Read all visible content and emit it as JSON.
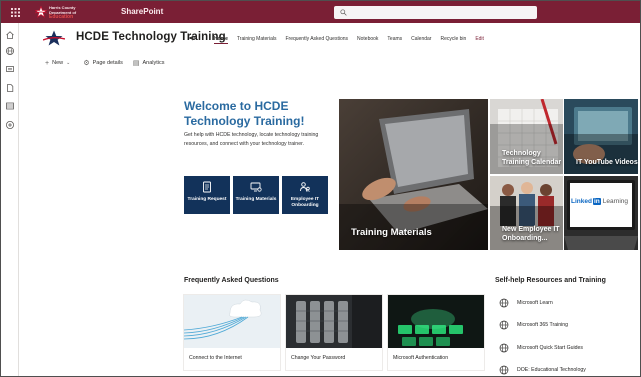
{
  "suite": {
    "app_name": "SharePoint",
    "logo_line1": "Harris County",
    "logo_line2": "Department of",
    "logo_line3": "Education",
    "search_placeholder": "",
    "brand_color": "#7a1f35"
  },
  "site": {
    "title": "HCDE Technology Training",
    "nav": [
      "Home",
      "Training Materials",
      "Frequently Asked Questions",
      "Notebook",
      "Teams",
      "Calendar",
      "Recycle bin",
      "Edit"
    ],
    "active_nav": "Home"
  },
  "commandbar": {
    "new_label": "New",
    "page_details_label": "Page details",
    "analytics_label": "Analytics"
  },
  "welcome": {
    "title": "Welcome to HCDE Technology Training!",
    "description": "Get help with HCDE technology, locate technology training resources, and connect with your technology trainer.",
    "buttons": [
      {
        "label": "Training Request",
        "icon": "document-icon"
      },
      {
        "label": "Training Materials",
        "icon": "monitor-settings-icon"
      },
      {
        "label": "Employee IT Onboarding",
        "icon": "people-icon"
      }
    ]
  },
  "hero": {
    "main_caption": "Training Materials",
    "tiles": [
      {
        "caption": "Technology Training Calendar"
      },
      {
        "caption": "IT YouTube Videos"
      },
      {
        "caption": "New Employee IT Onboarding..."
      },
      {
        "caption": "",
        "logo_text": "Linked",
        "logo_in": "in",
        "logo_suffix": "Learning"
      }
    ]
  },
  "faq": {
    "heading": "Frequently Asked Questions",
    "cards": [
      {
        "label": "Connect to the Internet"
      },
      {
        "label": "Change Your Password"
      },
      {
        "label": "Microsoft Authentication"
      }
    ]
  },
  "resources": {
    "heading": "Self-help Resources and Training",
    "items": [
      {
        "label": "Microsoft Learn"
      },
      {
        "label": "Microsoft 365 Training"
      },
      {
        "label": "Microsoft Quick Start Guides"
      },
      {
        "label": "DOE: Educational Technology"
      }
    ]
  }
}
